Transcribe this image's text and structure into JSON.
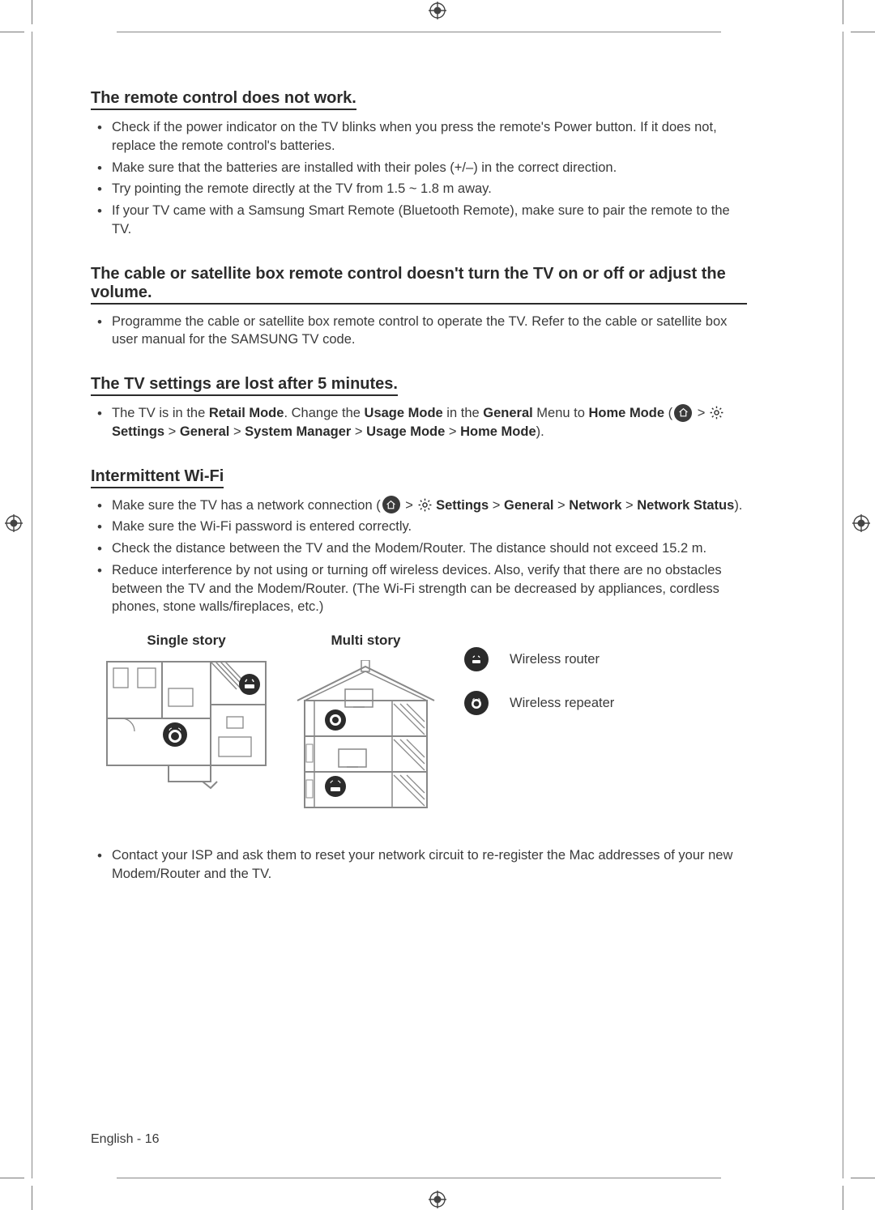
{
  "sections": {
    "remote": {
      "heading": "The remote control does not work.",
      "items": [
        "Check if the power indicator on the TV blinks when you press the remote's Power button. If it does not, replace the remote control's batteries.",
        "Make sure that the batteries are installed with their poles (+/–) in the correct direction.",
        "Try pointing the remote directly at the TV from 1.5 ~ 1.8 m away.",
        "If your TV came with a Samsung Smart Remote (Bluetooth Remote), make sure to pair the remote to the TV."
      ]
    },
    "cable": {
      "heading": "The cable or satellite box remote control doesn't turn the TV on or off or adjust the volume.",
      "items": [
        "Programme the cable or satellite box remote control to operate the TV. Refer to the cable or satellite box user manual for the SAMSUNG TV code."
      ]
    },
    "tvsettings": {
      "heading": "The TV settings are lost after 5 minutes.",
      "item_parts": {
        "p0": "The TV is in the ",
        "p1": "Retail Mode",
        "p2": ". Change the ",
        "p3": "Usage Mode",
        "p4": " in the ",
        "p5": "General",
        "p6": " Menu to ",
        "p7": "Home Mode",
        "p8": " (",
        "p9": " > ",
        "p10": " Settings",
        "p11": " > ",
        "p12": "General",
        "p13": " > ",
        "p14": "System Manager",
        "p15": " > ",
        "p16": "Usage Mode",
        "p17": " > ",
        "p18": "Home Mode",
        "p19": ")."
      }
    },
    "wifi": {
      "heading": "Intermittent Wi-Fi",
      "item1_parts": {
        "p0": "Make sure the TV has a network connection (",
        "p1": " > ",
        "p2": " Settings",
        "p3": " > ",
        "p4": "General",
        "p5": " > ",
        "p6": "Network",
        "p7": " > ",
        "p8": "Network Status",
        "p9": ")."
      },
      "item2": "Make sure the Wi-Fi password is entered correctly.",
      "item3": "Check the distance between the TV and the Modem/Router. The distance should not exceed 15.2 m.",
      "item4": "Reduce interference by not using or turning off wireless devices. Also, verify that there are no obstacles between the TV and the Modem/Router. (The Wi-Fi strength can be decreased by appliances, cordless phones, stone walls/fireplaces, etc.)",
      "item5": "Contact your ISP and ask them to reset your network circuit to re-register the Mac addresses of your new Modem/Router and the TV."
    }
  },
  "diagrams": {
    "single": "Single story",
    "multi": "Multi story",
    "legend": {
      "router": "Wireless router",
      "repeater": "Wireless repeater"
    }
  },
  "footer": "English - 16"
}
